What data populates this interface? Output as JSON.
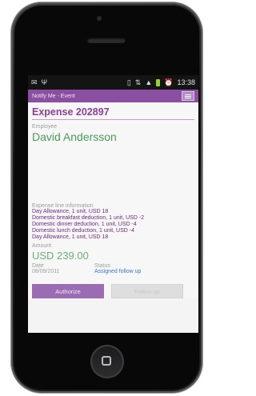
{
  "status_bar": {
    "left_icons": [
      "mail-icon",
      "usb-icon"
    ],
    "right_icons": [
      "vibrate-icon",
      "data-icon",
      "signal-icon",
      "battery-icon",
      "alarm-icon"
    ],
    "time": "13:38"
  },
  "app_bar": {
    "title": "Notify Me - Event",
    "menu_icon": "menu-icon"
  },
  "expense": {
    "title": "Expense 202897",
    "employee_label": "Employee",
    "employee_name": "David Andersson",
    "lines_label": "Expense line information",
    "lines": [
      "Day Allowance, 1 unit, USD 18",
      "Domestic breakfast deduction, 1 unit, USD -2",
      "Domestic dinner deduction, 1 unit, USD -4",
      "Domestic lunch deduction, 1 unit, USD -4",
      "Day Allowance, 1 unit, USD 18"
    ],
    "amount_label": "Amount",
    "amount": "USD 239.00",
    "date_label": "Date",
    "date": "08/09/2011",
    "status_label": "Status",
    "status": "Assigned follow up"
  },
  "buttons": {
    "authorize": "Authorize",
    "follow_up": "Follow up"
  },
  "colors": {
    "accent": "#8a4fa0",
    "employee_text": "#4a9a5a",
    "status_link": "#3a78c7"
  }
}
